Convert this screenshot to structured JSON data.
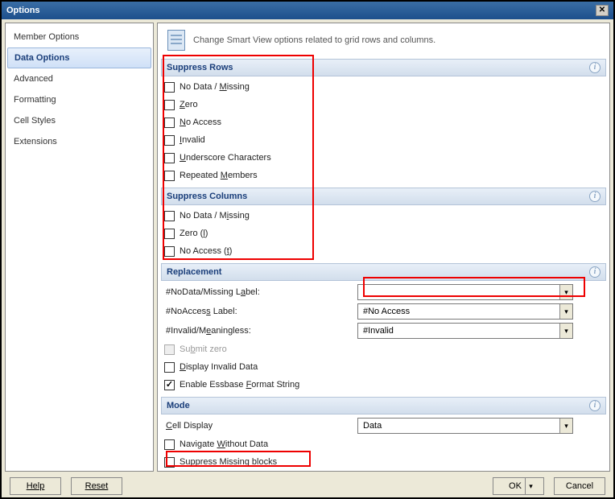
{
  "window": {
    "title": "Options"
  },
  "description": "Change Smart View options related to grid rows and columns.",
  "sidebar": {
    "items": [
      {
        "label": "Member Options",
        "selected": false
      },
      {
        "label": "Data Options",
        "selected": true
      },
      {
        "label": "Advanced",
        "selected": false
      },
      {
        "label": "Formatting",
        "selected": false
      },
      {
        "label": "Cell Styles",
        "selected": false
      },
      {
        "label": "Extensions",
        "selected": false
      }
    ]
  },
  "sections": {
    "suppress_rows": {
      "title": "Suppress Rows",
      "items": [
        {
          "label_html": "No Data / <span class='underline-char'>M</span>issing",
          "checked": false
        },
        {
          "label_html": "<span class='underline-char'>Z</span>ero",
          "checked": false
        },
        {
          "label_html": "<span class='underline-char'>N</span>o Access",
          "checked": false
        },
        {
          "label_html": "<span class='underline-char'>I</span>nvalid",
          "checked": false
        },
        {
          "label_html": "<span class='underline-char'>U</span>nderscore Characters",
          "checked": false
        },
        {
          "label_html": "Repeated <span class='underline-char'>M</span>embers",
          "checked": false
        }
      ]
    },
    "suppress_columns": {
      "title": "Suppress Columns",
      "items": [
        {
          "label_html": "No Data / M<span class='underline-char'>i</span>ssing",
          "checked": false
        },
        {
          "label_html": "Zero (<span class='underline-char'>l</span>)",
          "checked": false
        },
        {
          "label_html": "No Access (<span class='underline-char'>t</span>)",
          "checked": false
        }
      ]
    },
    "replacement": {
      "title": "Replacement",
      "nodata_label_text": "#NoData/Missing L<span class='underline-char'>a</span>bel:",
      "nodata_value": "",
      "noaccess_label_text": "#NoAcces<span class='underline-char'>s</span> Label:",
      "noaccess_value": "#No Access",
      "invalid_label_text": "#Invalid/M<span class='underline-char'>e</span>aningless:",
      "invalid_value": "#Invalid",
      "submit_zero_label": "Su<span class='underline-char'>b</span>mit zero",
      "submit_zero_checked": false,
      "submit_zero_disabled": true,
      "display_invalid_label": "<span class='underline-char'>D</span>isplay Invalid Data",
      "display_invalid_checked": false,
      "enable_essbase_label": "Enable Essbase <span class='underline-char'>F</span>ormat String",
      "enable_essbase_checked": true
    },
    "mode": {
      "title": "Mode",
      "cell_display_label": "<span class='underline-char'>C</span>ell Display",
      "cell_display_value": "Data",
      "nav_without_data_label": "Navigate <span class='underline-char'>W</span>ithout Data",
      "nav_without_data_checked": false,
      "suppress_missing_label": "Su<span class='underline-char'>p</span>press Missing blocks",
      "suppress_missing_checked": false
    }
  },
  "footer": {
    "help": "Help",
    "reset": "Reset",
    "ok": "OK",
    "cancel": "Cancel"
  }
}
